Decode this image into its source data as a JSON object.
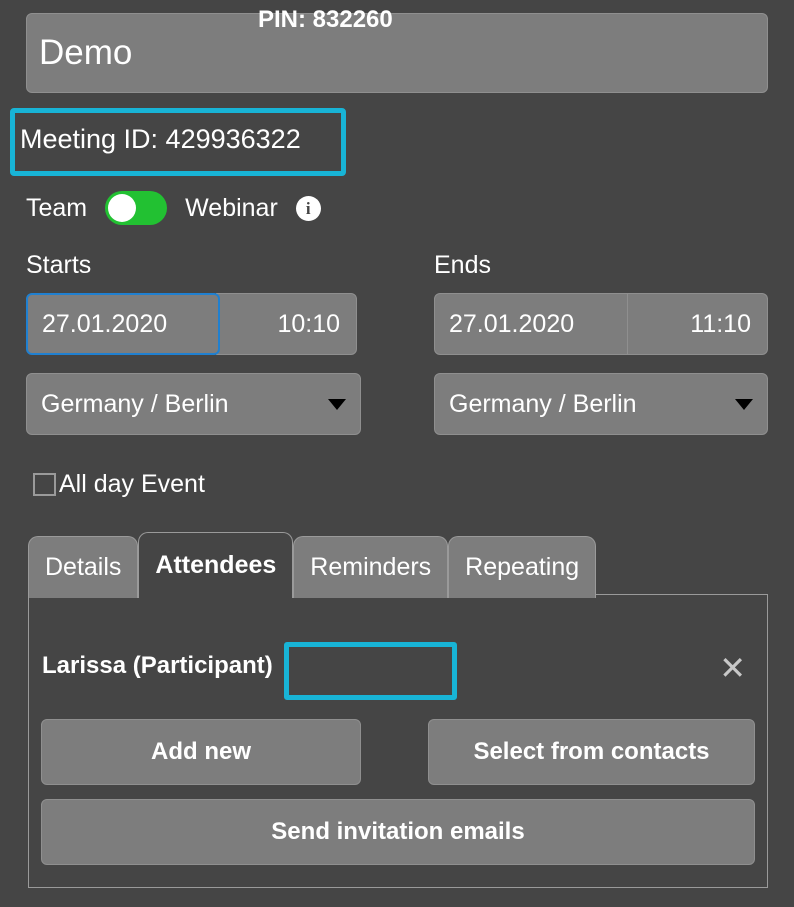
{
  "form": {
    "title_value": "Demo",
    "title_placeholder": "Title",
    "meeting_id_label": "Meeting ID: 429936322",
    "meeting_id_number": "429936322",
    "highlight_color": "#18b4d6",
    "focus_color": "#2080d0",
    "toggle": {
      "left_label": "Team",
      "right_label": "Webinar",
      "state": "Team",
      "on_color": "#22c132",
      "info_icon_glyph": "i"
    },
    "starts": {
      "label": "Starts",
      "date": "27.01.2020",
      "time": "10:10",
      "timezone": "Germany / Berlin"
    },
    "ends": {
      "label": "Ends",
      "date": "27.01.2020",
      "time": "11:10",
      "timezone": "Germany / Berlin"
    },
    "all_day": {
      "label": "All day Event",
      "checked": false
    }
  },
  "tabs": [
    {
      "label": "Details",
      "active": false
    },
    {
      "label": "Attendees",
      "active": true
    },
    {
      "label": "Reminders",
      "active": false
    },
    {
      "label": "Repeating",
      "active": false
    }
  ],
  "attendees_panel": {
    "attendee": {
      "name": "Larissa (Participant)",
      "pin_label": "PIN: 832260",
      "pin_number": "832260",
      "remove_glyph": "✕"
    },
    "buttons": {
      "add_new": "Add new",
      "select_from_contacts": "Select from contacts",
      "send_invitation_emails": "Send invitation emails"
    }
  }
}
